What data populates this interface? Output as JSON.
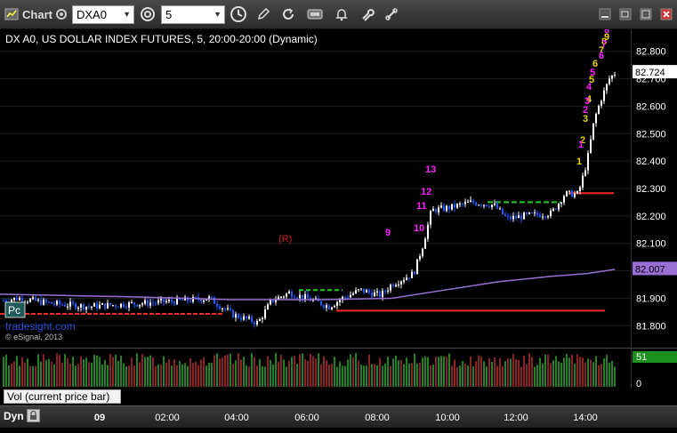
{
  "toolbar": {
    "chart_label": "Chart",
    "symbol_value": "DXA0",
    "interval_value": "5"
  },
  "chart": {
    "header": "DX A0, US DOLLAR INDEX FUTURES, 5, 20:00-20:00 (Dynamic)",
    "watermark_brand": "tradesight.com",
    "copyright": "© eSignal, 2013",
    "pc_badge": "Pc",
    "r_marker": "(R)",
    "current_price_label": "82.724",
    "ma_price_label": "82.007",
    "colors": {
      "up": "#ffffff",
      "down": "#1e5bff",
      "ma": "#9a6fd6",
      "resistance": "#ff2a2a",
      "support_green": "#22cc22",
      "setup_magenta": "#ff22ff",
      "setup_yellow": "#e6d200",
      "setup_green": "#2faa2a"
    }
  },
  "chart_data": {
    "type": "candlestick",
    "ylim": [
      81.72,
      82.88
    ],
    "price_ticks": [
      "82.800",
      "82.700",
      "82.600",
      "82.500",
      "82.400",
      "82.300",
      "82.200",
      "82.100",
      "82.000",
      "81.900",
      "81.800"
    ],
    "time_ticks": [
      "09",
      "02:00",
      "04:00",
      "06:00",
      "08:00",
      "10:00",
      "12:00",
      "14:00"
    ],
    "volume_ticks": [
      "51",
      "0"
    ],
    "current_volume": 51,
    "moving_average_last": 82.007,
    "last_price": 82.724,
    "levels": [
      {
        "color": "red",
        "price": 81.843
      },
      {
        "color": "red",
        "price": 81.855
      },
      {
        "color": "red",
        "price": 82.283
      },
      {
        "color": "green",
        "price": 81.93
      },
      {
        "color": "green",
        "price": 82.25
      }
    ],
    "setup_counts": [
      {
        "text": "1",
        "color": "yellow"
      },
      {
        "text": "2",
        "color": "yellow"
      },
      {
        "text": "3",
        "color": "yellow"
      },
      {
        "text": "4",
        "color": "yellow"
      },
      {
        "text": "5",
        "color": "yellow"
      },
      {
        "text": "6",
        "color": "yellow"
      },
      {
        "text": "7",
        "color": "yellow"
      },
      {
        "text": "8",
        "color": "yellow"
      },
      {
        "text": "9",
        "color": "yellow"
      },
      {
        "text": "1",
        "color": "magenta"
      },
      {
        "text": "2",
        "color": "magenta"
      },
      {
        "text": "3",
        "color": "magenta"
      },
      {
        "text": "4",
        "color": "magenta"
      },
      {
        "text": "5",
        "color": "magenta"
      },
      {
        "text": "6",
        "color": "magenta"
      },
      {
        "text": "7",
        "color": "magenta"
      },
      {
        "text": "8",
        "color": "magenta"
      },
      {
        "text": "9",
        "color": "magenta"
      },
      {
        "text": "10",
        "color": "magenta"
      },
      {
        "text": "11",
        "color": "magenta"
      },
      {
        "text": "12",
        "color": "magenta"
      },
      {
        "text": "13",
        "color": "magenta"
      }
    ]
  },
  "volume_panel": {
    "label": "Vol (current price bar)"
  },
  "bottom": {
    "mode_label": "Dyn"
  }
}
